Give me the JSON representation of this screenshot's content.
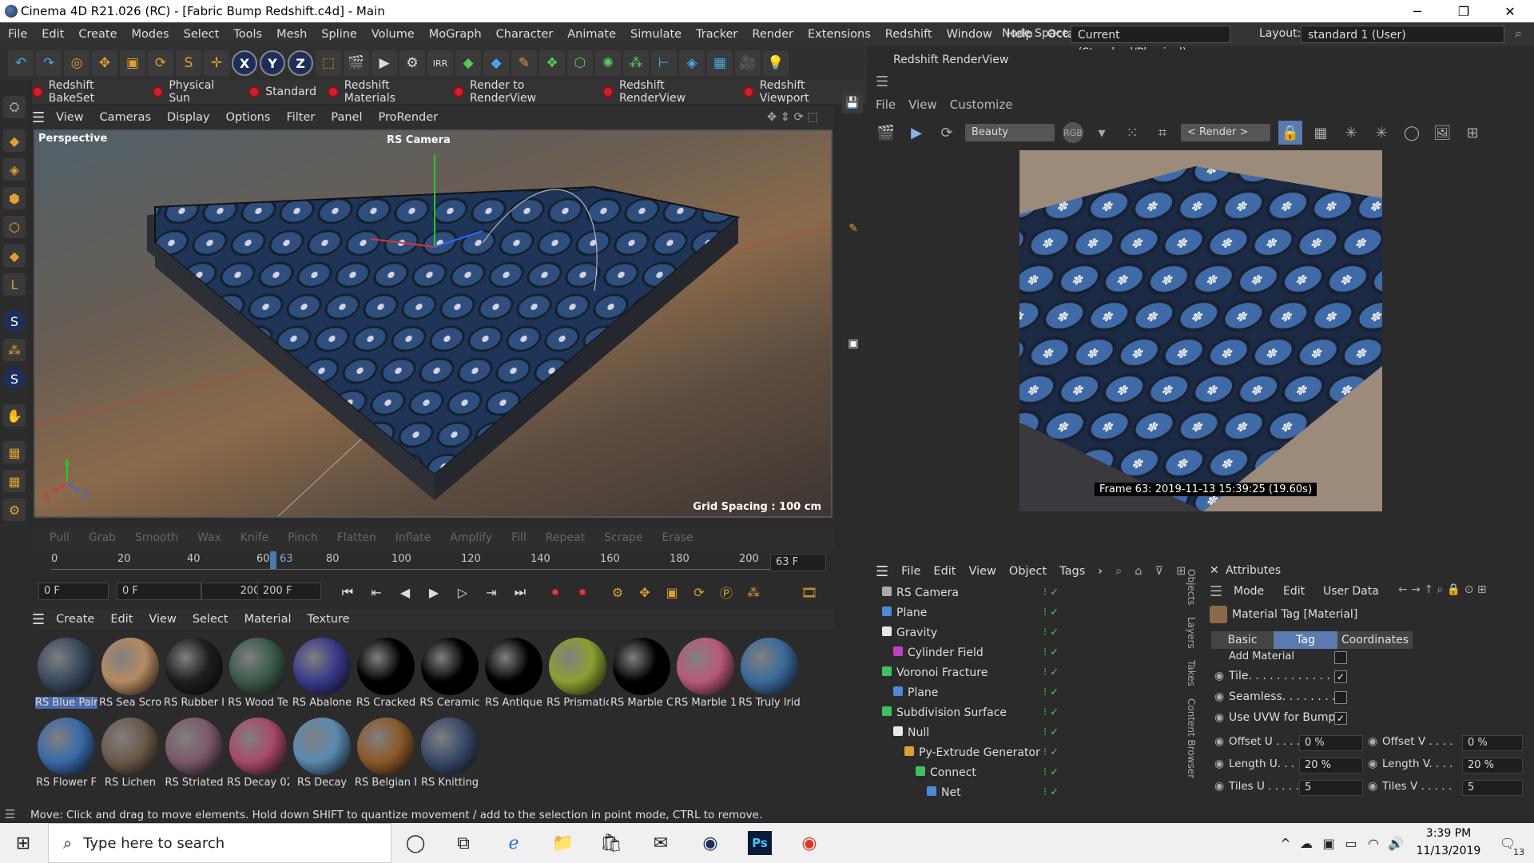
{
  "window": {
    "title": "Cinema 4D R21.026 (RC) - [Fabric Bump Redshift.c4d] - Main",
    "minimize": "─",
    "restore": "❐",
    "close": "✕"
  },
  "menubar": {
    "items": [
      "File",
      "Edit",
      "Create",
      "Modes",
      "Select",
      "Tools",
      "Mesh",
      "Spline",
      "Volume",
      "MoGraph",
      "Character",
      "Animate",
      "Simulate",
      "Tracker",
      "Render",
      "Extensions",
      "Redshift",
      "Window",
      "Help",
      "Octane"
    ],
    "node_space_label": "Node Space:",
    "node_space_value": "Current (Standard/Physical)",
    "layout_label": "Layout:",
    "layout_value": "standard 1 (User)"
  },
  "toolbar": {
    "x": "X",
    "y": "Y",
    "z": "Z"
  },
  "redshift_bar": {
    "items": [
      "Redshift BakeSet",
      "Physical Sun",
      "Standard",
      "Redshift Materials",
      "Render to RenderView",
      "Redshift RenderView",
      "Redshift Viewport"
    ]
  },
  "viewport": {
    "menu": [
      "View",
      "Cameras",
      "Display",
      "Options",
      "Filter",
      "Panel",
      "ProRender"
    ],
    "label": "Perspective",
    "camera": "RS Camera",
    "grid_spacing": "Grid Spacing : 100 cm",
    "axis_y": "Y",
    "axis_x": "X",
    "axis_z": "Z"
  },
  "sculpt_tools": [
    "Pull",
    "Grab",
    "Smooth",
    "Wax",
    "Knife",
    "Pinch",
    "Flatten",
    "Inflate",
    "Amplify",
    "Fill",
    "Repeat",
    "Scrape",
    "Erase"
  ],
  "timeline": {
    "ticks": [
      "0",
      "20",
      "40",
      "60",
      "80",
      "100",
      "120",
      "140",
      "160",
      "180",
      "200"
    ],
    "current_marker": "63",
    "current_frame": "63 F",
    "start_field": "0 F",
    "min_field": "0 F",
    "max_field": "200 F",
    "end_field": "200 F"
  },
  "material_menu": [
    "Create",
    "Edit",
    "View",
    "Select",
    "Material",
    "Texture"
  ],
  "materials": [
    {
      "name": "RS Blue Pair",
      "color": "#3b4a5e"
    },
    {
      "name": "RS Sea Scro",
      "color": "#b58a62"
    },
    {
      "name": "RS Rubber I",
      "color": "#1e1e1e"
    },
    {
      "name": "RS Wood Te",
      "color": "#3a5a4a"
    },
    {
      "name": "RS Abalone",
      "color": "#3a3a8a"
    },
    {
      "name": "RS Cracked",
      "color": "#000000"
    },
    {
      "name": "RS Ceramic",
      "color": "#000000"
    },
    {
      "name": "RS Antique",
      "color": "#000000"
    },
    {
      "name": "RS Prismatic",
      "color": "#8aa030"
    },
    {
      "name": "RS Marble C",
      "color": "#000000"
    },
    {
      "name": "RS Marble 1",
      "color": "#b85a7a"
    },
    {
      "name": "RS Truly Irid",
      "color": "#3a6a9a"
    },
    {
      "name": "RS Flower F",
      "color": "#3a6aa8"
    },
    {
      "name": "RS Lichen",
      "color": "#6a5a4a"
    },
    {
      "name": "RS Striated",
      "color": "#7a5a6a"
    },
    {
      "name": "RS Decay 02",
      "color": "#a84a6a"
    },
    {
      "name": "RS Decay",
      "color": "#5a8ab0"
    },
    {
      "name": "RS Belgian I",
      "color": "#8a5a2a"
    },
    {
      "name": "RS Knitting",
      "color": "#3a4a6a"
    }
  ],
  "status": "Move: Click and drag to move elements. Hold down SHIFT to quantize movement / add to the selection in point mode, CTRL to remove.",
  "renderview": {
    "title": "Redshift RenderView",
    "menu": [
      "File",
      "View",
      "Customize"
    ],
    "aov": "Beauty",
    "rgb": "RGB",
    "render_dropdown": "< Render >",
    "frame_info": "Frame  63:  2019-11-13  15:39:25  (19.60s)"
  },
  "objects": {
    "menu": [
      "File",
      "Edit",
      "View",
      "Object",
      "Tags"
    ],
    "rows": [
      {
        "name": "RS Camera",
        "indent": 0,
        "color": "#aaaaaa"
      },
      {
        "name": "Plane",
        "indent": 0,
        "color": "#4a8ad8"
      },
      {
        "name": "Gravity",
        "indent": 0,
        "color": "#e8e8e8"
      },
      {
        "name": "Cylinder Field",
        "indent": 1,
        "color": "#c040c0"
      },
      {
        "name": "Voronoi Fracture",
        "indent": 0,
        "color": "#40c060"
      },
      {
        "name": "Plane",
        "indent": 1,
        "color": "#4a8ad8"
      },
      {
        "name": "Subdivision Surface",
        "indent": 0,
        "color": "#40c060"
      },
      {
        "name": "Null",
        "indent": 1,
        "color": "#e8e8e8"
      },
      {
        "name": "Py-Extrude Generator",
        "indent": 2,
        "color": "#e0a030"
      },
      {
        "name": "Connect",
        "indent": 3,
        "color": "#40c060"
      },
      {
        "name": "Net",
        "indent": 4,
        "color": "#4a8ad8"
      }
    ],
    "side_tabs": [
      "Objects",
      "Layers",
      "Takes",
      "Content Browser"
    ]
  },
  "attributes": {
    "title": "Attributes",
    "menu": [
      "Mode",
      "Edit",
      "User Data"
    ],
    "header": "Material Tag [Material]",
    "tabs": [
      "Basic",
      "Tag",
      "Coordinates"
    ],
    "active_tab": "Tag",
    "add_material": "Add Material",
    "tile": "Tile. . . . . . . . . . . . .",
    "seamless": "Seamless. . . . . . . . .",
    "use_uvw": "Use UVW for Bump",
    "offset_u_label": "Offset U . . . .",
    "offset_u": "0 %",
    "offset_v_label": "Offset V . . . .",
    "offset_v": "0 %",
    "length_u_label": "Length U. . . .",
    "length_u": "20 %",
    "length_v_label": "Length V. . . .",
    "length_v": "20 %",
    "tiles_u_label": "Tiles U . . . . .",
    "tiles_u": "5",
    "tiles_v_label": "Tiles V . . . . .",
    "tiles_v": "5"
  },
  "taskbar": {
    "search_placeholder": "Type here to search",
    "time": "3:39 PM",
    "date": "11/13/2019",
    "notifications": "13"
  }
}
